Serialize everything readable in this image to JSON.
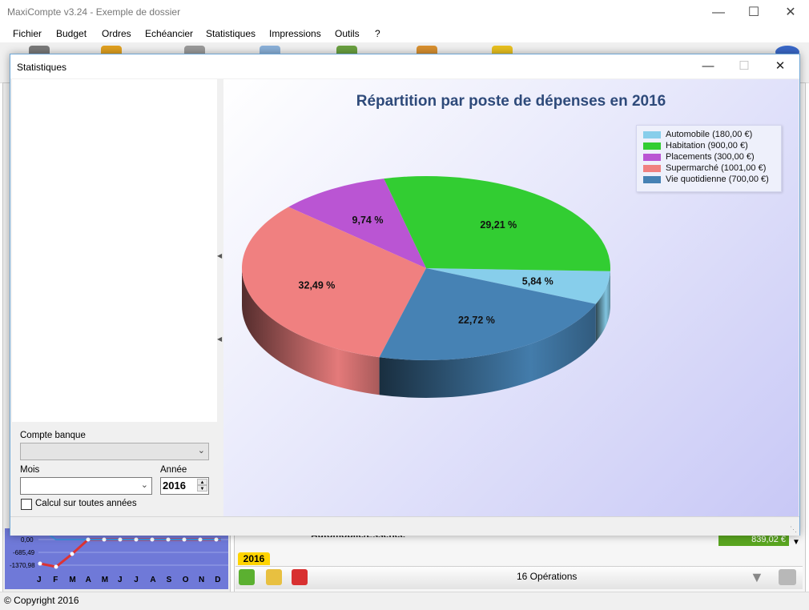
{
  "app": {
    "title": "MaxiCompte v3.24 - Exemple de dossier",
    "menu": [
      "Fichier",
      "Budget",
      "Ordres",
      "Echéancier",
      "Statistiques",
      "Impressions",
      "Outils",
      "?"
    ],
    "copyright": "© Copyright 2016"
  },
  "background": {
    "category_text": "Automobile/Essence",
    "amount": "839,02 €",
    "year_tab": "2016",
    "operations": "16 Opérations",
    "mini_chart": {
      "y_labels": [
        "0,00",
        "-685,49",
        "-1370,98"
      ],
      "months": [
        "J",
        "F",
        "M",
        "A",
        "M",
        "J",
        "J",
        "A",
        "S",
        "O",
        "N",
        "D"
      ]
    }
  },
  "dialog": {
    "title": "Statistiques",
    "form": {
      "compte_label": "Compte banque",
      "compte_value": "",
      "mois_label": "Mois",
      "mois_value": "",
      "annee_label": "Année",
      "annee_value": "2016",
      "calc_label": "Calcul sur toutes années",
      "calc_checked": false
    }
  },
  "chart_data": {
    "type": "pie",
    "title": "Répartition par poste de dépenses en 2016",
    "legend_position": "top-right",
    "slices": [
      {
        "name": "Automobile",
        "legend": "Automobile (180,00 €)",
        "value": 180.0,
        "percent_label": "5,84 %",
        "color": "#87ceeb"
      },
      {
        "name": "Habitation",
        "legend": "Habitation (900,00 €)",
        "value": 900.0,
        "percent_label": "29,21 %",
        "color": "#32cd32"
      },
      {
        "name": "Placements",
        "legend": "Placements (300,00 €)",
        "value": 300.0,
        "percent_label": "9,74 %",
        "color": "#ba55d3"
      },
      {
        "name": "Supermarché",
        "legend": "Supermarché (1001,00 €)",
        "value": 1001.0,
        "percent_label": "32,49 %",
        "color": "#f08080"
      },
      {
        "name": "Vie quotidienne",
        "legend": "Vie quotidienne (700,00 €)",
        "value": 700.0,
        "percent_label": "22,72 %",
        "color": "#4682b4"
      }
    ]
  }
}
